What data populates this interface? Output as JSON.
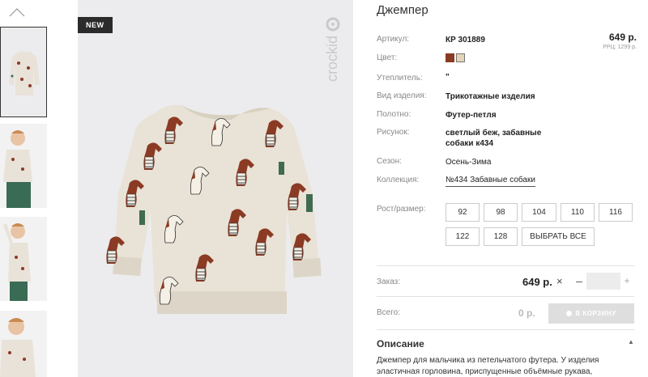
{
  "product": {
    "title": "Джемпер",
    "badge": "NEW",
    "brand": "crockid",
    "price": "649 р.",
    "rrp": "РРЦ: 1299 р."
  },
  "details": [
    {
      "label": "Артикул:",
      "value": "КР 301889"
    },
    {
      "label": "Цвет:",
      "value": ""
    },
    {
      "label": "Утеплитель:",
      "value": "\""
    },
    {
      "label": "Вид изделия:",
      "value": "Трикотажные изделия"
    },
    {
      "label": "Полотно:",
      "value": "Футер-петля"
    },
    {
      "label": "Рисунок:",
      "value": "светлый беж, забавные собаки к434"
    },
    {
      "label": "Сезон:",
      "value": "Осень-Зима"
    },
    {
      "label": "Коллекция:",
      "value": "№434 Забавные собаки"
    }
  ],
  "colors": [
    "#8b3a24",
    "#e3d4b8"
  ],
  "sizes": {
    "label": "Рост/размер:",
    "options": [
      "92",
      "98",
      "104",
      "110",
      "116",
      "122",
      "128"
    ],
    "select_all": "ВЫБРАТЬ ВСЕ"
  },
  "order": {
    "label": "Заказ:",
    "price": "649 р.",
    "times": "×",
    "minus": "–",
    "plus": "+",
    "quantity": ""
  },
  "total": {
    "label": "Всего:",
    "value": "0 р.",
    "cart_button": "В КОРЗИНУ"
  },
  "description": {
    "title": "Описание",
    "toggle": "▲",
    "text": "Джемпер для мальчика из петельчатого футера. У изделия эластичная горловина, приспущенные объёмные рукава,"
  }
}
